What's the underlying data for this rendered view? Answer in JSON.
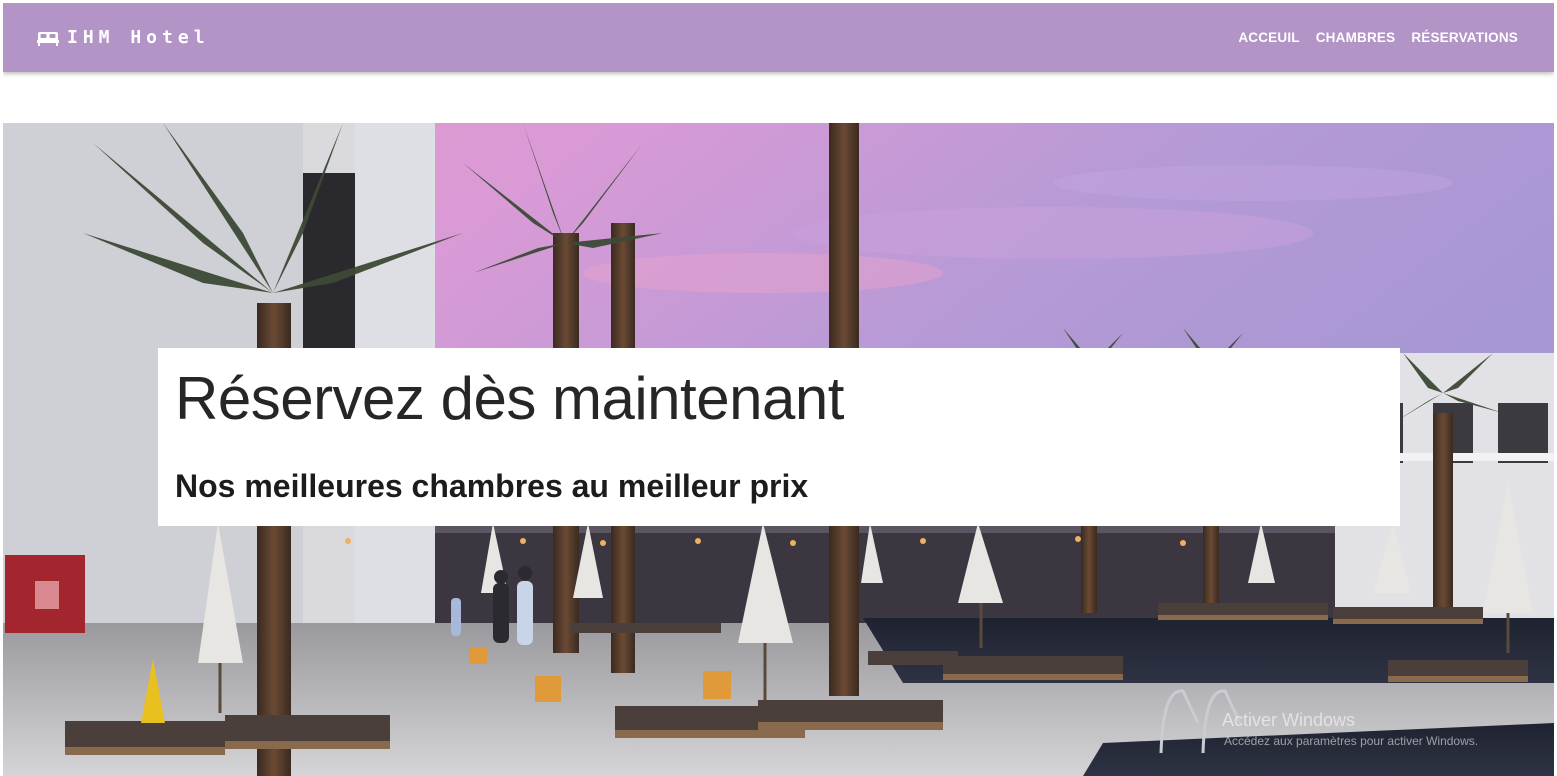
{
  "navbar": {
    "brand_icon": "bed-icon",
    "brand_text": "IHM Hotel",
    "background": "#b294c7",
    "links": [
      {
        "label": "ACCEUIL"
      },
      {
        "label": "CHAMBRES"
      },
      {
        "label": "RÉSERVATIONS"
      }
    ]
  },
  "hero": {
    "image": "hotel-pool-palms-sunset-photo",
    "title": "Réservez dès maintenant",
    "subtitle": "Nos meilleures chambres au meilleur prix"
  },
  "watermark": {
    "title": "Activer Windows",
    "subtitle": "Accédez aux paramètres pour activer Windows."
  }
}
